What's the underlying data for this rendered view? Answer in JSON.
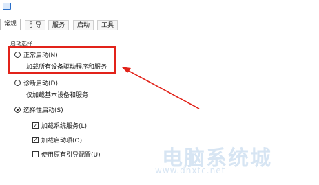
{
  "tabs": [
    {
      "label": "常规"
    },
    {
      "label": "引导"
    },
    {
      "label": "服务"
    },
    {
      "label": "启动"
    },
    {
      "label": "工具"
    }
  ],
  "startup_group": {
    "legend": "启动选择",
    "normal": {
      "label": "正常启动(N)",
      "description": "加载所有设备驱动程序和服务"
    },
    "diagnostic": {
      "label": "诊断启动(D)",
      "description": "仅加载基本设备和服务"
    },
    "selective": {
      "label": "选择性启动(S)",
      "options": [
        {
          "label": "加载系统服务(L)",
          "checked": true
        },
        {
          "label": "加载启动项(O)",
          "checked": true
        },
        {
          "label": "使用原有引导配置(U)",
          "checked": false
        }
      ]
    }
  },
  "annotation": {
    "color": "#e2231a"
  },
  "watermark": {
    "text": "电脑系统城",
    "url": "www.dnxtc.net"
  }
}
